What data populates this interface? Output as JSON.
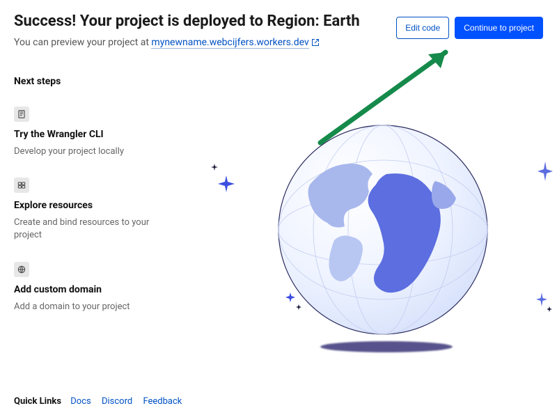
{
  "header": {
    "title": "Success! Your project is deployed to Region: Earth",
    "subtitle_prefix": "You can preview your project at ",
    "project_url_label": "mynewname.webcijfers.workers.dev"
  },
  "buttons": {
    "edit": "Edit code",
    "continue": "Continue to project"
  },
  "next_steps": {
    "heading": "Next steps",
    "items": [
      {
        "icon": "document-icon",
        "title": "Try the Wrangler CLI",
        "desc": "Develop your project locally"
      },
      {
        "icon": "resources-icon",
        "title": "Explore resources",
        "desc": "Create and bind resources to your project"
      },
      {
        "icon": "globe-small-icon",
        "title": "Add custom domain",
        "desc": "Add a domain to your project"
      }
    ]
  },
  "quick_links": {
    "label": "Quick Links",
    "items": [
      "Docs",
      "Discord",
      "Feedback"
    ]
  }
}
